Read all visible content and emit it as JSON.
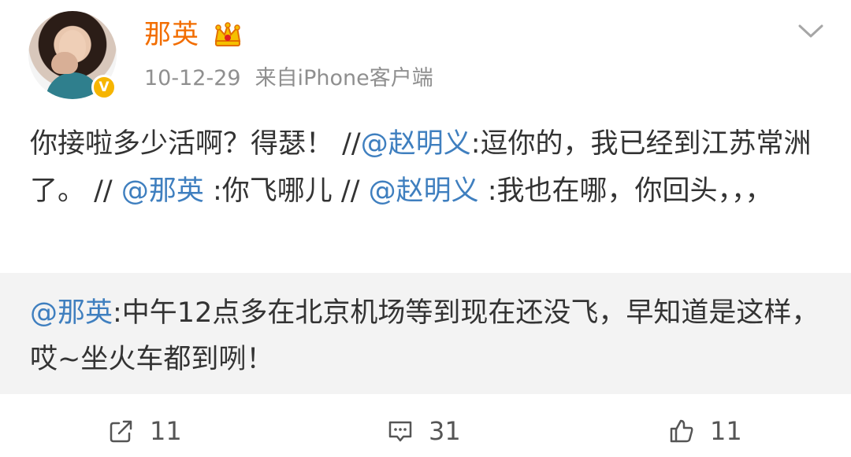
{
  "user": {
    "name": "那英",
    "verified_icon": "verified-badge-icon",
    "crown_icon": "crown-icon",
    "date": "10-12-29",
    "source": "来自iPhone客户端"
  },
  "post": {
    "parts": [
      "你接啦多少活啊？得瑟！ //",
      "@赵明义",
      ":逗你的，我已经到江苏常洲了。 // ",
      "@那英",
      " :你飞哪儿 // ",
      "@赵明义",
      " :我也在哪，你回头，，，"
    ]
  },
  "quoted": {
    "mention": "@那英",
    "text": ":中午12点多在北京机场等到现在还没飞，早知道是这样，哎~坐火车都到咧！"
  },
  "actions": {
    "repost_count": "11",
    "comment_count": "31",
    "like_count": "11"
  },
  "colors": {
    "name": "#f26d00",
    "mention": "#3f7fbf",
    "muted": "#8f8f8f",
    "quote_background": "#f3f3f3"
  }
}
